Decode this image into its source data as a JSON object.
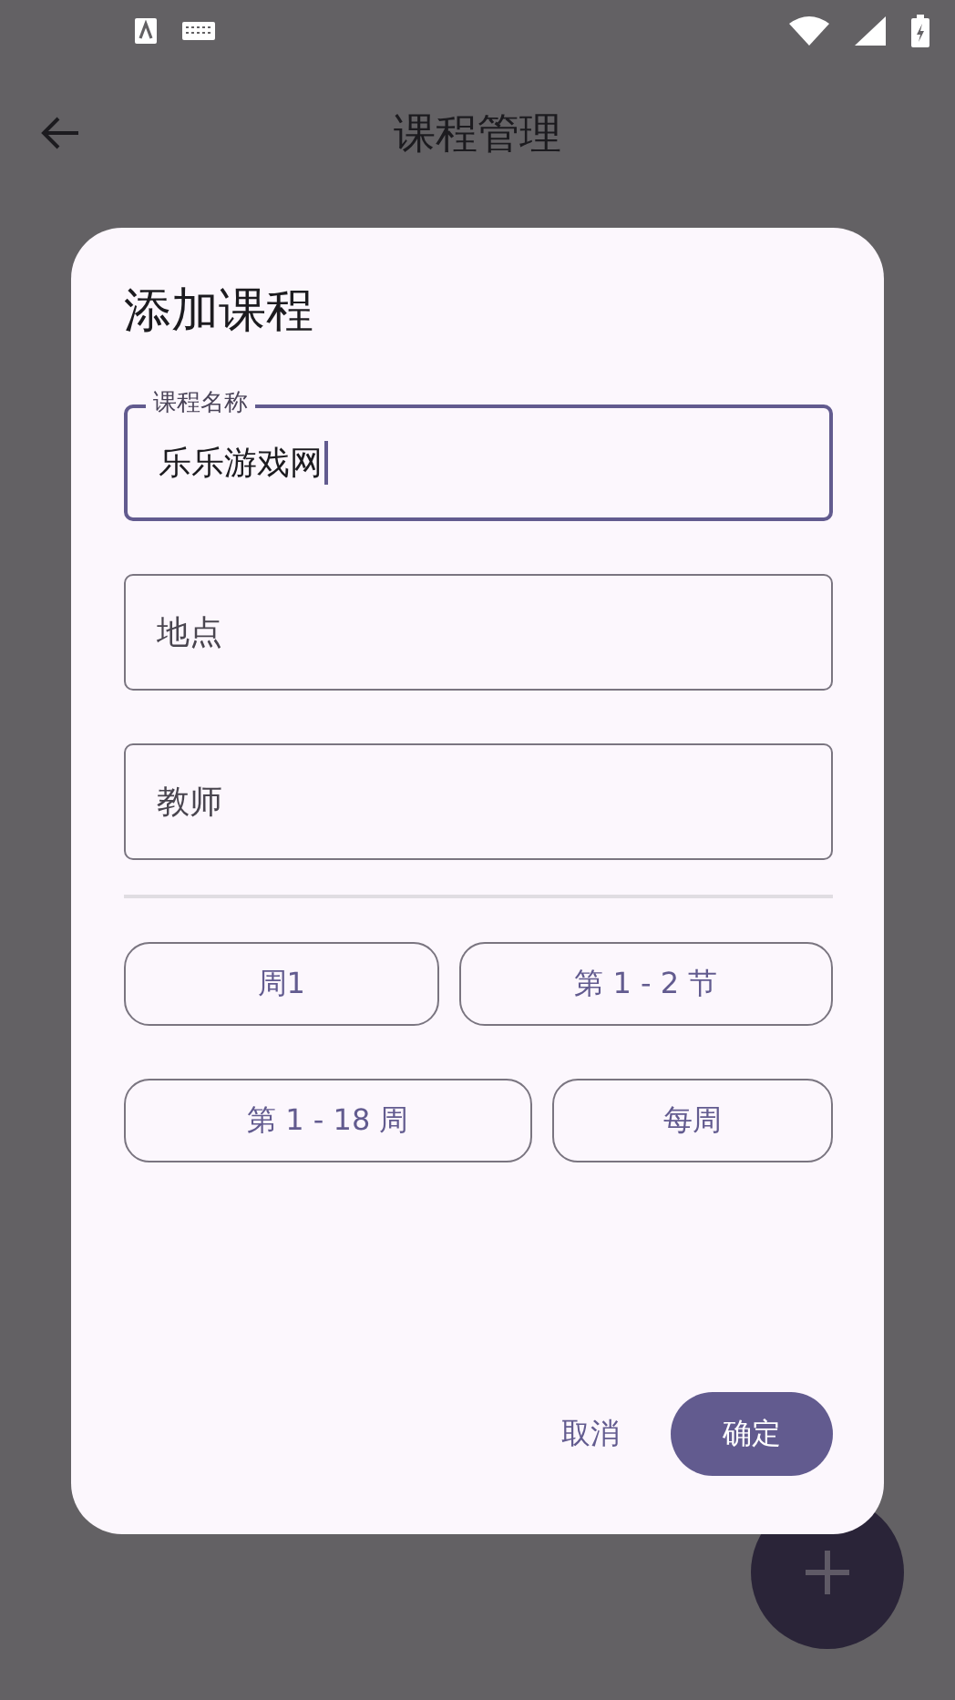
{
  "app_bar": {
    "title": "课程管理"
  },
  "dialog": {
    "title": "添加课程",
    "fields": [
      {
        "label": "课程名称",
        "value": "乐乐游戏网",
        "focused": true
      },
      {
        "label": "地点",
        "focused": false
      },
      {
        "label": "教师",
        "focused": false
      }
    ],
    "selector_rows": [
      {
        "items": [
          {
            "label": "周1"
          },
          {
            "label": "第 1 - 2 节"
          }
        ]
      },
      {
        "items": [
          {
            "label": "第 1 - 18 周"
          },
          {
            "label": "每周"
          }
        ]
      }
    ],
    "actions": [
      {
        "label": "取消",
        "kind": "text"
      },
      {
        "label": "确定",
        "kind": "filled"
      }
    ]
  }
}
